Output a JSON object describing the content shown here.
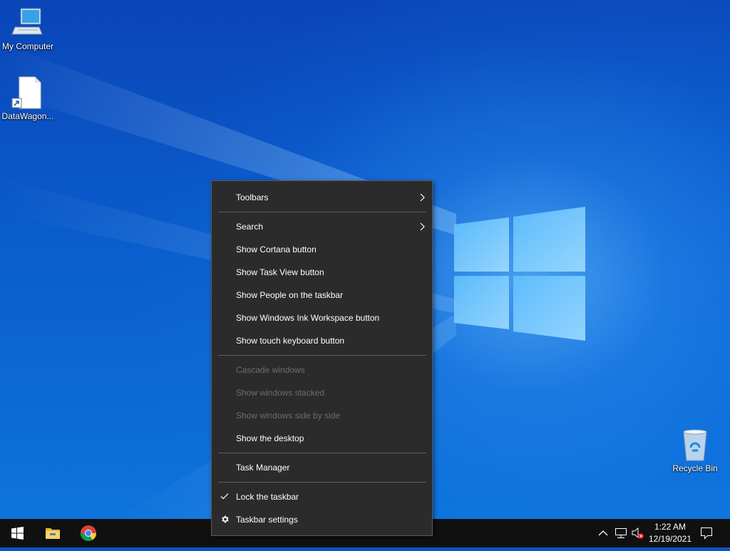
{
  "desktop": {
    "icons": [
      {
        "label": "My Computer",
        "icon": "computer-icon"
      },
      {
        "label": "DataWagon...",
        "icon": "file-shortcut-icon"
      },
      {
        "label": "Recycle Bin",
        "icon": "recycle-bin-icon"
      }
    ]
  },
  "context_menu": {
    "items": [
      {
        "label": "Toolbars",
        "enabled": true,
        "submenu": true
      },
      {
        "label": "Search",
        "enabled": true,
        "submenu": true
      },
      {
        "label": "Show Cortana button",
        "enabled": true
      },
      {
        "label": "Show Task View button",
        "enabled": true
      },
      {
        "label": "Show People on the taskbar",
        "enabled": true
      },
      {
        "label": "Show Windows Ink Workspace button",
        "enabled": true
      },
      {
        "label": "Show touch keyboard button",
        "enabled": true
      },
      {
        "label": "Cascade windows",
        "enabled": false
      },
      {
        "label": "Show windows stacked",
        "enabled": false
      },
      {
        "label": "Show windows side by side",
        "enabled": false
      },
      {
        "label": "Show the desktop",
        "enabled": true
      },
      {
        "label": "Task Manager",
        "enabled": true
      },
      {
        "label": "Lock the taskbar",
        "enabled": true,
        "checked": true
      },
      {
        "label": "Taskbar settings",
        "enabled": true,
        "icon": "gear-icon"
      }
    ]
  },
  "taskbar": {
    "buttons": [
      "start-icon",
      "file-explorer-icon",
      "chrome-icon"
    ],
    "tray": {
      "icons": [
        "chevron-up-icon",
        "network-icon",
        "volume-muted-icon",
        "notification-icon"
      ],
      "time": "1:22 AM",
      "date": "12/19/2021"
    }
  },
  "colors": {
    "menu_bg": "#2b2b2b",
    "taskbar_bg": "#101010",
    "disabled_text": "#6d6d6d"
  }
}
